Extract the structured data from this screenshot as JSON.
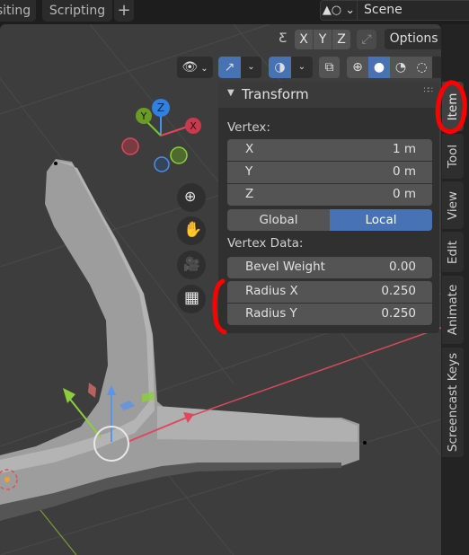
{
  "workspace_tabs": [
    {
      "label": "siting"
    },
    {
      "label": "Scripting"
    },
    {
      "label": "+"
    }
  ],
  "scene": {
    "icon": "scene-icon",
    "name": "Scene"
  },
  "header_row1": {
    "mirror_icon": "mirror-butterfly-icon",
    "axes": [
      "X",
      "Y",
      "Z"
    ],
    "snap_icon": "auto-merge-icon",
    "options_label": "Options"
  },
  "header_row2": {
    "visibility_icon": "visibility-eye-icon",
    "gizmo_icon": "gizmo-icon",
    "overlay_icon": "overlay-icon",
    "xray_icon": "xray-toggle-icon",
    "shading_modes": [
      {
        "name": "wireframe",
        "active": false
      },
      {
        "name": "solid",
        "active": true
      },
      {
        "name": "material-preview",
        "active": false
      },
      {
        "name": "rendered",
        "active": false
      }
    ]
  },
  "gizmo": {
    "axes": [
      {
        "label": "X",
        "color": "#c83a4c"
      },
      {
        "label": "Y",
        "color": "#6c9a26"
      },
      {
        "label": "Z",
        "color": "#2f80e0"
      }
    ]
  },
  "nav_buttons": [
    {
      "name": "zoom-icon"
    },
    {
      "name": "pan-hand-icon"
    },
    {
      "name": "camera-icon"
    },
    {
      "name": "ortho-grid-icon"
    }
  ],
  "transform_panel": {
    "title": "Transform",
    "vertex_label": "Vertex:",
    "vertex": [
      {
        "label": "X",
        "value": "1 m"
      },
      {
        "label": "Y",
        "value": "0 m"
      },
      {
        "label": "Z",
        "value": "0 m"
      }
    ],
    "space_toggle": [
      {
        "label": "Global",
        "active": false
      },
      {
        "label": "Local",
        "active": true
      }
    ],
    "vertex_data_label": "Vertex Data:",
    "bevel_weight": {
      "label": "Bevel Weight",
      "value": "0.00"
    },
    "radius": [
      {
        "label": "Radius X",
        "value": "0.250"
      },
      {
        "label": "Radius Y",
        "value": "0.250"
      }
    ]
  },
  "sidebar_tabs": [
    {
      "label": "Item",
      "active": true
    },
    {
      "label": "Tool",
      "active": false
    },
    {
      "label": "View",
      "active": false
    },
    {
      "label": "Edit",
      "active": false
    },
    {
      "label": "Animate",
      "active": false
    },
    {
      "label": "Screencast Keys",
      "active": false
    }
  ],
  "colors": {
    "accent": "#4772b3",
    "annotation_red": "#ff0000",
    "x_axis": "#e0475b",
    "y_axis": "#7ac232",
    "z_axis": "#4d8fe8"
  }
}
